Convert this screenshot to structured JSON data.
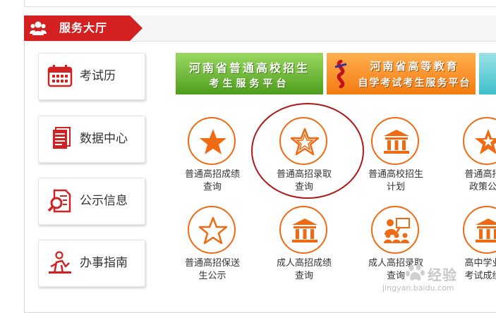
{
  "header": {
    "title": "服务大厅",
    "icon": "users-icon",
    "accent": "#d42020"
  },
  "sidebar": {
    "items": [
      {
        "label": "考试历",
        "icon": "calendar-icon"
      },
      {
        "label": "数据中心",
        "icon": "document-stack-icon"
      },
      {
        "label": "公示信息",
        "icon": "search-document-icon"
      },
      {
        "label": "办事指南",
        "icon": "person-guide-icon"
      }
    ]
  },
  "banners": [
    {
      "line1": "河南省普通高校招生",
      "line2": "考生服务平台",
      "color": "#5aa825"
    },
    {
      "line1": "河南省高等教育",
      "line2": "自学考试考生服务平台",
      "color": "#f47a10"
    }
  ],
  "services": [
    {
      "label": "普通高招成绩\n查询",
      "icon": "star-filled-icon"
    },
    {
      "label": "普通高招录取\n查询",
      "icon": "star-outline-icon"
    },
    {
      "label": "普通高校招生\n计划",
      "icon": "building-icon"
    },
    {
      "label": "普通高招照\n政策公示",
      "icon": "star-filled-icon"
    },
    {
      "label": "普通高招保送\n生公示",
      "icon": "star-outline-icon"
    },
    {
      "label": "成人高招成绩\n查询",
      "icon": "building-icon"
    },
    {
      "label": "成人高招录取\n查询",
      "icon": "presenter-icon"
    },
    {
      "label": "高中学业水\n考试成绩查",
      "icon": "building-icon"
    }
  ],
  "watermark": {
    "text": "经验",
    "url": "jingyan.baidu.com"
  },
  "colors": {
    "icon_orange": "#f06a14",
    "highlight": "#b01818"
  }
}
